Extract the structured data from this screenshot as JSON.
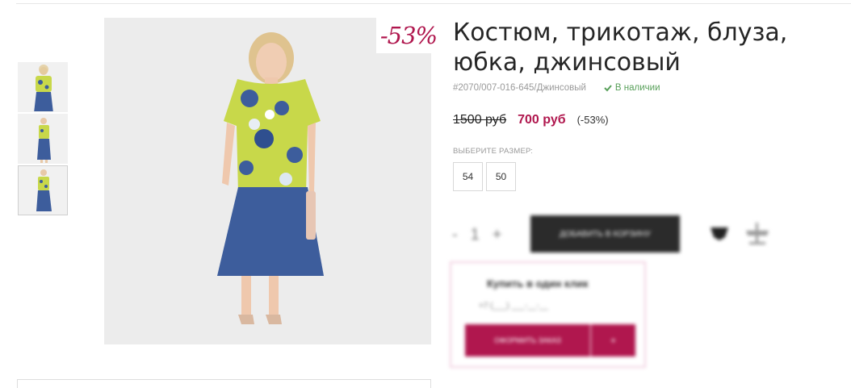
{
  "product": {
    "title": "Костюм, трикотаж, блуза, юбка, джинсовый",
    "sku": "#2070/007-016-645/Джинсовый",
    "stock": "В наличии",
    "discount_tag": "-53%",
    "old_price": "1500 руб",
    "new_price": "700 руб",
    "discount_pct": "(-53%)"
  },
  "sizes": {
    "label": "ВЫБЕРИТЕ РАЗМЕР:",
    "options": [
      "54",
      "50"
    ]
  },
  "purchase": {
    "qty_minus": "-",
    "qty_value": "1",
    "qty_plus": "+",
    "cart_label": "ДОБАВИТЬ В КОРЗИНУ",
    "oneclick_title": "Купить в один клик",
    "oneclick_sub": "+7 (___) ___-__-__",
    "oneclick_button": "ОФОРМИТЬ ЗАКАЗ",
    "oneclick_button2": "+"
  },
  "colors": {
    "accent": "#b0174e",
    "stock_green": "#58a05a",
    "blouse": "#c8d84a",
    "skirt": "#3d5d9c"
  },
  "icons": [
    "check-icon",
    "heart-icon",
    "compare-scale-icon"
  ]
}
